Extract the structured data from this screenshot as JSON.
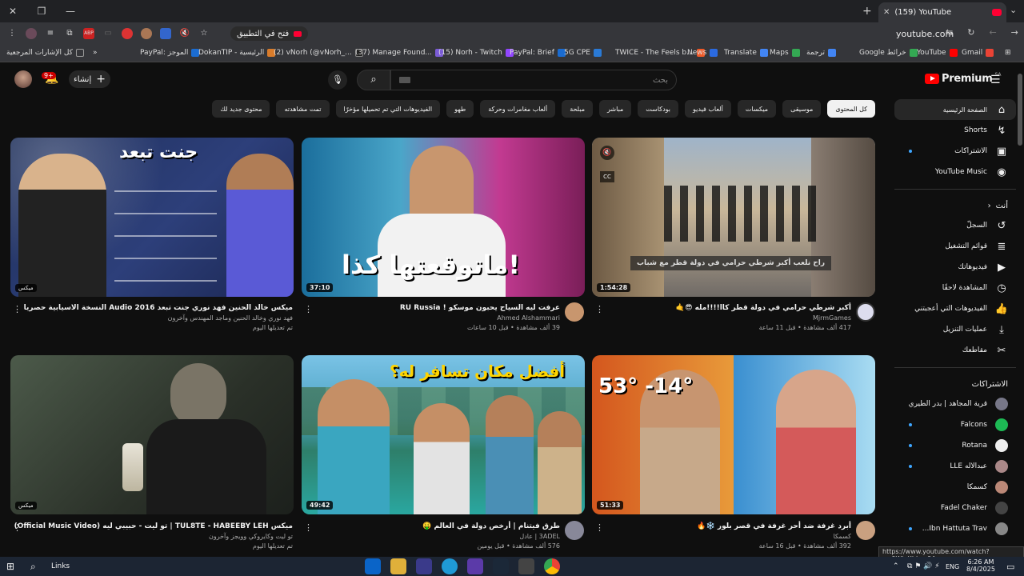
{
  "browser": {
    "tab_title": "(159) YouTube",
    "url": "youtube.com",
    "open_in_app": "فتح في التطبيق",
    "bookmarks": [
      {
        "label": "كل الإشارات المرجعية",
        "color": "#999"
      },
      {
        "label": "PayPal: الموجز",
        "color": "#1b6cd1"
      },
      {
        "label": "DokanTIP - الرئيسية",
        "color": "#d97c2b"
      },
      {
        "label": "(2) vNorh (@vNorh_...",
        "color": "#222"
      },
      {
        "label": "(37) Manage Found...",
        "color": "#7b5cd6"
      },
      {
        "label": "(15) Norh - Twitch",
        "color": "#9146ff"
      },
      {
        "label": "PayPal: Brief",
        "color": "#1b6cd1"
      },
      {
        "label": "5G CPE",
        "color": "#2a7ad6"
      },
      {
        "label": "TWICE - The Feels b...",
        "color": "#f05a28"
      },
      {
        "label": "News",
        "color": "#2b6ae0"
      },
      {
        "label": "Translate",
        "color": "#4285f4"
      },
      {
        "label": "Maps",
        "color": "#34a853"
      },
      {
        "label": "ترجمة",
        "color": "#4285f4"
      },
      {
        "label": "Google خرائط",
        "color": "#34a853"
      },
      {
        "label": "YouTube",
        "color": "#ff0000"
      },
      {
        "label": "Gmail",
        "color": "#ea4335"
      }
    ]
  },
  "header": {
    "notification_count": "9+",
    "create_label": "إنشاء",
    "search_placeholder": "بحث",
    "logo_text": "Premium",
    "country_code": "SA"
  },
  "chips": [
    "كل المحتوى",
    "موسيقى",
    "ميكسات",
    "ألعاب فيديو",
    "بودكاست",
    "مباشر",
    "مبلحة",
    "ألعاب مغامرات وحركة",
    "طهو",
    "الفيديوهات التي تم تحميلها مؤخرًا",
    "تمت مشاهدته",
    "محتوى جديد لك"
  ],
  "sidebar": {
    "main": [
      {
        "label": "الصفحة الرئيسية",
        "icon": "home-icon",
        "glyph": "⌂",
        "active": true
      },
      {
        "label": "Shorts",
        "icon": "shorts-icon",
        "glyph": "↯"
      },
      {
        "label": "الاشتراكات",
        "icon": "subscriptions-icon",
        "glyph": "▣",
        "dot": true
      },
      {
        "label": "YouTube Music",
        "icon": "music-icon",
        "glyph": "◉"
      }
    ],
    "you_header": "أنت",
    "you": [
      {
        "label": "السجلّ",
        "icon": "history-icon",
        "glyph": "↺"
      },
      {
        "label": "قوائم التشغيل",
        "icon": "playlist-icon",
        "glyph": "≣"
      },
      {
        "label": "فيديوهاتك",
        "icon": "your-videos-icon",
        "glyph": "▶"
      },
      {
        "label": "المشاهدة لاحقًا",
        "icon": "watch-later-icon",
        "glyph": "◷"
      },
      {
        "label": "الفيديوهات التي أعجبتني",
        "icon": "like-icon",
        "glyph": "👍"
      },
      {
        "label": "عمليات التنزيل",
        "icon": "download-icon",
        "glyph": "⤓"
      },
      {
        "label": "مقاطعك",
        "icon": "clips-icon",
        "glyph": "✂"
      }
    ],
    "subs_header": "الاشتراكات",
    "subs": [
      {
        "label": "قرية المجاهد | بدر الطيري",
        "color": "#778",
        "dot": false
      },
      {
        "label": "Falcons",
        "color": "#1db954",
        "dot": true
      },
      {
        "label": "Rotana",
        "color": "#eee",
        "dot": true
      },
      {
        "label": "عبدالاله LLE",
        "color": "#a88",
        "dot": true
      },
      {
        "label": "كسمكا",
        "color": "#b87",
        "dot": false
      },
      {
        "label": "Fadel Chaker",
        "color": "#444",
        "dot": false
      },
      {
        "label": "Ibn Hattuta Trav...",
        "color": "#888",
        "dot": true
      }
    ]
  },
  "videos": [
    {
      "title": "أكبر شرطي حرامي في دولة قطر كاا!!!!مله 😎🤙",
      "channel": "MjrmGames",
      "stats": "417 ألف مشاهدة • قبل 11 ساعة",
      "duration": "1:54:28",
      "thumb_caption": "راح نلعب أكبر شرطي حرامي في دولة قطر مع شباب"
    },
    {
      "title": "عرفت ليه السياح يحبون موسكو ! RU Russia",
      "channel": "Ahmed Alshammari",
      "stats": "39 ألف مشاهدة • قبل 10 ساعات",
      "duration": "37:10",
      "thumb_caption": "ماتوقعتها كذا!"
    },
    {
      "title": "ميكس خالد الحنين فهد نوري جنت تبعد 2016 Audio النسخة الاسيابية حصريا",
      "channel": "فهد نوري وخالد الحنين وماجد المهندس وآخرون",
      "stats": "تم تعديلها اليوم",
      "duration": "ميكس",
      "thumb_caption": "جنت تبعد"
    },
    {
      "title": "أبرد غرفة ضد أحر غرفة في قصر بلور ❄️🔥",
      "channel": "كسمكا",
      "stats": "392 ألف مشاهدة • قبل 16 ساعة",
      "duration": "51:33",
      "thumb_caption": "53°  -14°"
    },
    {
      "title": "طرق فيتنام | أرخص دولة في العالم 🤑",
      "channel": "3ADEL | عادل",
      "stats": "576 ألف مشاهدة • قبل يومين",
      "duration": "49:42",
      "thumb_caption": "أفضل مكان تسافر له؟"
    },
    {
      "title": "ميكس TUL8TE - HABEEBY LEH | تو ليت - حبيبي ليه (Official Music Video)",
      "channel": "تو ليت وكايروكي وويجز وآخرون",
      "stats": "تم تعديلها اليوم",
      "duration": "ميكس",
      "thumb_caption": ""
    }
  ],
  "status_link": "https://www.youtube.com/watch?v=9WjyXhh_n94",
  "taskbar": {
    "search_label": "Links",
    "time": "6:26 AM",
    "date": "8/4/2025",
    "lang": "ENG"
  }
}
